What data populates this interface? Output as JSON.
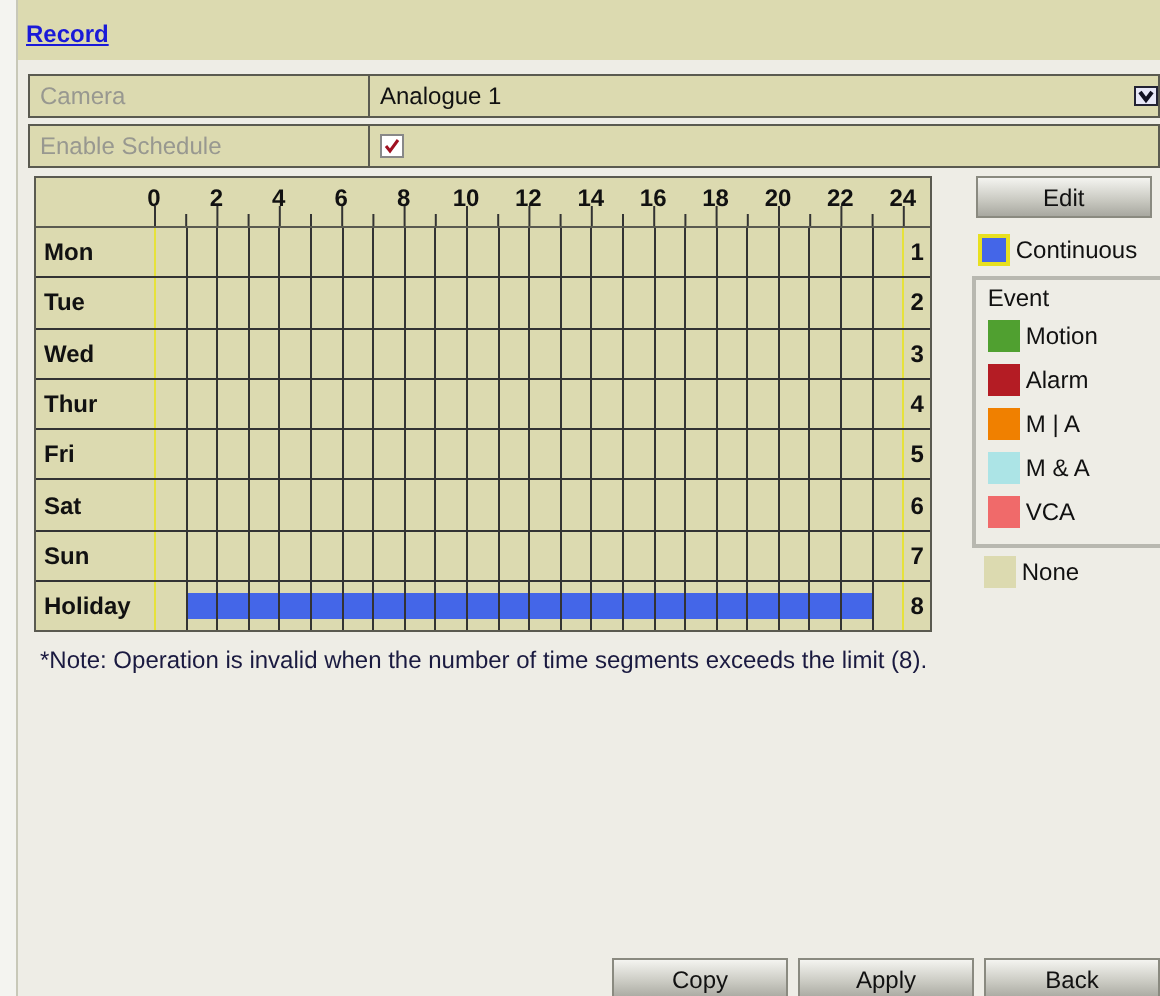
{
  "header": {
    "title": "Record"
  },
  "fields": [
    {
      "label": "Camera",
      "kind": "dropdown",
      "value": "Analogue 1"
    },
    {
      "label": "Enable Schedule",
      "kind": "checkbox",
      "checked": true
    }
  ],
  "schedule": {
    "hour_labels": [
      "0",
      "2",
      "4",
      "6",
      "8",
      "10",
      "12",
      "14",
      "16",
      "18",
      "20",
      "22",
      "24"
    ],
    "days": [
      {
        "name": "Mon",
        "number": "1",
        "hours": [
          false,
          false,
          false,
          false,
          false,
          false,
          false,
          false,
          false,
          false,
          false,
          false,
          false,
          false,
          false,
          false,
          false,
          false,
          false,
          false,
          false,
          false,
          false,
          false
        ]
      },
      {
        "name": "Tue",
        "number": "2",
        "hours": [
          false,
          false,
          false,
          false,
          false,
          false,
          false,
          false,
          false,
          false,
          false,
          false,
          false,
          false,
          false,
          false,
          false,
          false,
          false,
          false,
          false,
          false,
          false,
          false
        ]
      },
      {
        "name": "Wed",
        "number": "3",
        "hours": [
          false,
          false,
          false,
          false,
          false,
          false,
          false,
          false,
          false,
          false,
          false,
          false,
          false,
          false,
          false,
          false,
          false,
          false,
          false,
          false,
          false,
          false,
          false,
          false
        ]
      },
      {
        "name": "Thur",
        "number": "4",
        "hours": [
          false,
          false,
          false,
          false,
          false,
          false,
          false,
          false,
          false,
          false,
          false,
          false,
          false,
          false,
          false,
          false,
          false,
          false,
          false,
          false,
          false,
          false,
          false,
          false
        ]
      },
      {
        "name": "Fri",
        "number": "5",
        "hours": [
          false,
          false,
          false,
          false,
          false,
          false,
          false,
          false,
          false,
          false,
          false,
          false,
          false,
          false,
          false,
          false,
          false,
          false,
          false,
          false,
          false,
          false,
          false,
          false
        ]
      },
      {
        "name": "Sat",
        "number": "6",
        "hours": [
          false,
          false,
          false,
          false,
          false,
          false,
          false,
          false,
          false,
          false,
          false,
          false,
          false,
          false,
          false,
          false,
          false,
          false,
          false,
          false,
          false,
          false,
          false,
          false
        ]
      },
      {
        "name": "Sun",
        "number": "7",
        "hours": [
          false,
          false,
          false,
          false,
          false,
          false,
          false,
          false,
          false,
          false,
          false,
          false,
          false,
          false,
          false,
          false,
          false,
          false,
          false,
          false,
          false,
          false,
          false,
          false
        ]
      },
      {
        "name": "Holiday",
        "number": "8",
        "hours": [
          false,
          true,
          true,
          true,
          true,
          true,
          true,
          true,
          true,
          true,
          true,
          true,
          true,
          true,
          true,
          true,
          true,
          true,
          true,
          true,
          true,
          true,
          true,
          false
        ]
      }
    ]
  },
  "edit_button": "Edit",
  "legend": {
    "continuous": {
      "label": "Continuous",
      "color": "#4466e8",
      "selected": true
    },
    "event_title": "Event",
    "events": [
      {
        "label": "Motion",
        "color": "#50a030",
        "selected": false
      },
      {
        "label": "Alarm",
        "color": "#b41c24",
        "selected": false
      },
      {
        "label": "M | A",
        "color": "#f08000",
        "selected": false
      },
      {
        "label": "M & A",
        "color": "#ace4e6",
        "selected": false
      },
      {
        "label": "VCA",
        "color": "#f06a6a",
        "selected": false
      }
    ],
    "none": {
      "label": "None",
      "color": "#dcdab0",
      "selected": false
    }
  },
  "note": "*Note: Operation is invalid when the number of time segments exceeds the limit (8).",
  "buttons": [
    "Copy",
    "Apply",
    "Back"
  ]
}
